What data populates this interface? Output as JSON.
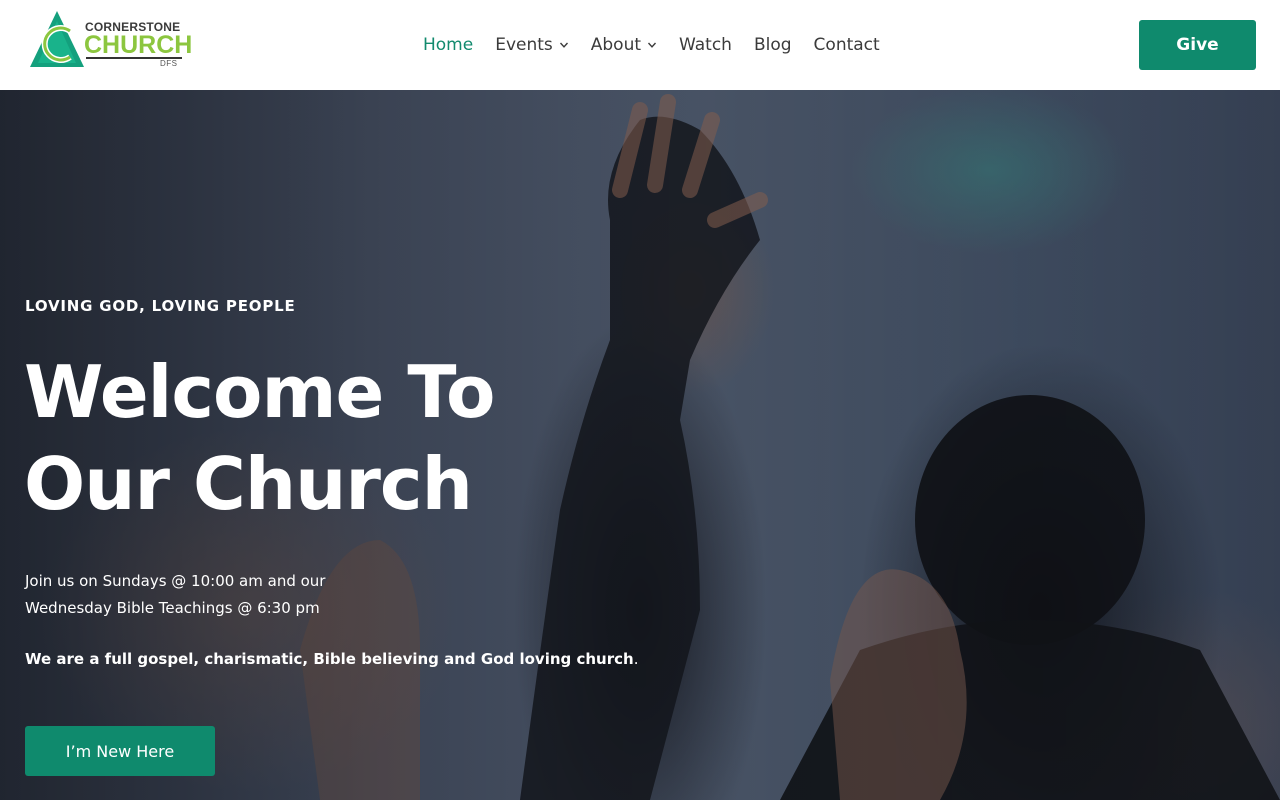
{
  "brand": {
    "line1": "CORNERSTONE",
    "line2": "CHURCH",
    "line3": "DFS",
    "colors": {
      "green": "#8cc63f",
      "teal": "#0f8a6d",
      "dark": "#3a3a3a"
    }
  },
  "nav": {
    "items": [
      {
        "label": "Home",
        "active": true,
        "has_dropdown": false
      },
      {
        "label": "Events",
        "active": false,
        "has_dropdown": true
      },
      {
        "label": "About",
        "active": false,
        "has_dropdown": true
      },
      {
        "label": "Watch",
        "active": false,
        "has_dropdown": false
      },
      {
        "label": "Blog",
        "active": false,
        "has_dropdown": false
      },
      {
        "label": "Contact",
        "active": false,
        "has_dropdown": false
      }
    ],
    "icons": {
      "dropdown": "chevron-down-icon"
    }
  },
  "header": {
    "give_label": "Give"
  },
  "hero": {
    "kicker": "LOVING GOD, LOVING PEOPLE",
    "title_line1": "Welcome To",
    "title_line2": "Our Church",
    "desc_line1": "Join us on Sundays @ 10:00 am and our",
    "desc_line2": "Wednesday Bible Teachings @ 6:30 pm",
    "statement_bold": "We are a full gospel, charismatic, Bible believing and God loving church",
    "statement_tail": ".",
    "cta_label": "I’m New Here",
    "image_subject": "worship crowd with raised hands"
  }
}
